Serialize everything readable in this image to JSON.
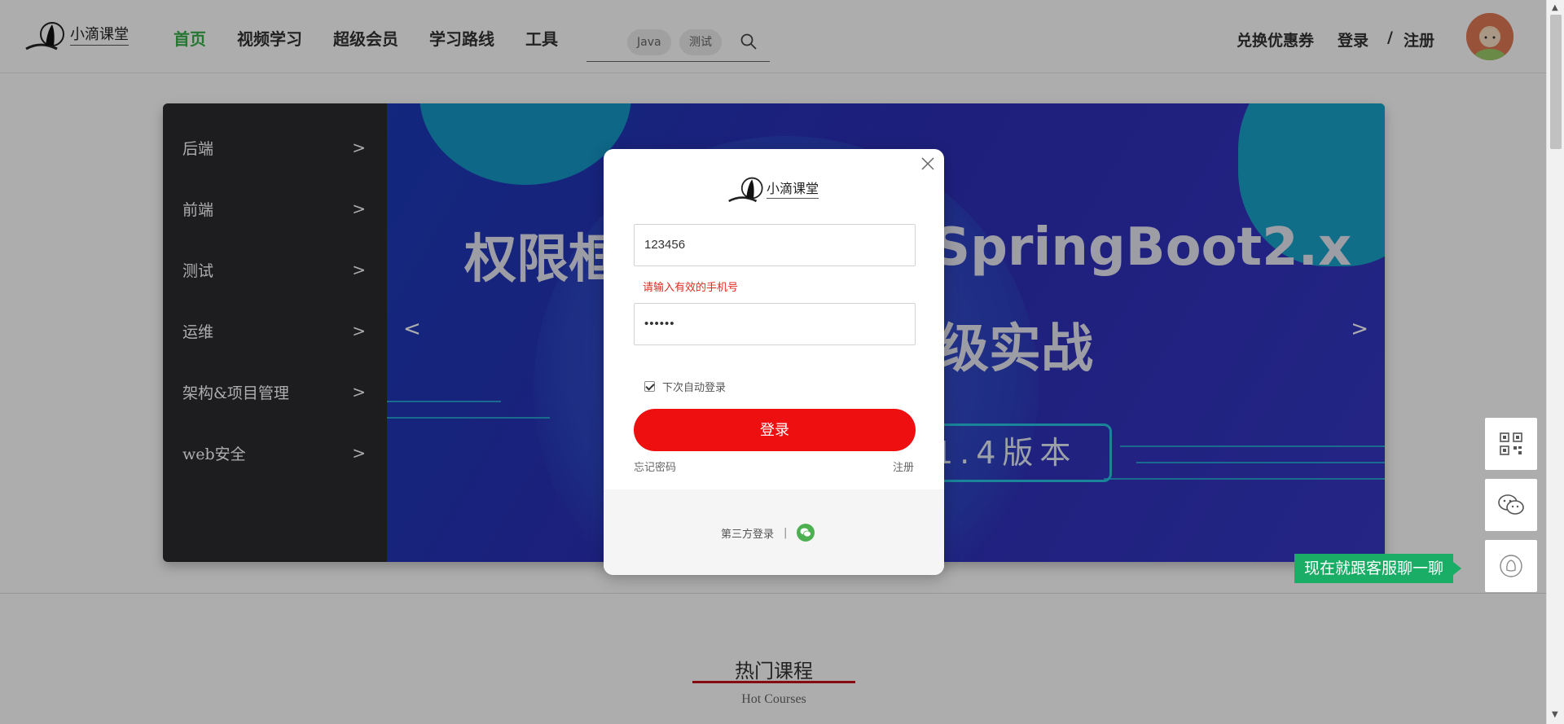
{
  "header": {
    "logo_text": "小滴课堂",
    "nav": [
      "首页",
      "视频学习",
      "超级会员",
      "学习路线",
      "工具"
    ],
    "search_tags": [
      "Java",
      "测试"
    ],
    "right_links": {
      "coupon": "兑换优惠券",
      "login": "登录",
      "slash": "/",
      "register": "注册"
    }
  },
  "side_menu": [
    {
      "label": "后端",
      "arrow": ">"
    },
    {
      "label": "前端",
      "arrow": ">"
    },
    {
      "label": "测试",
      "arrow": ">"
    },
    {
      "label": "运维",
      "arrow": ">"
    },
    {
      "label": "架构&项目管理",
      "arrow": ">"
    },
    {
      "label": "web安全",
      "arrow": ">"
    }
  ],
  "banner": {
    "title_left": "权限框",
    "title_right": "SpringBoot2.x",
    "title_line2": "级实战",
    "badge": "1.4版本",
    "prev": "<",
    "next": ">"
  },
  "modal": {
    "logo_text": "小滴课堂",
    "phone_value": "123456",
    "error": "请输入有效的手机号",
    "password_mask": "••••••",
    "remember_label": "下次自动登录",
    "login_button": "登录",
    "forgot": "忘记密码",
    "register": "注册",
    "third_party": "第三方登录",
    "separator": "|"
  },
  "section": {
    "title": "热门课程",
    "subtitle": "Hot Courses"
  },
  "float_panel": {
    "chat_tip": "现在就跟客服聊一聊"
  },
  "colors": {
    "accent_green": "#38b04a",
    "login_red": "#ee1010",
    "error_red": "#e5281e",
    "chat_green": "#19ad66"
  },
  "icons": [
    "search-icon",
    "close-icon",
    "qrcode-icon",
    "wechat-icon",
    "qq-icon",
    "avatar"
  ]
}
